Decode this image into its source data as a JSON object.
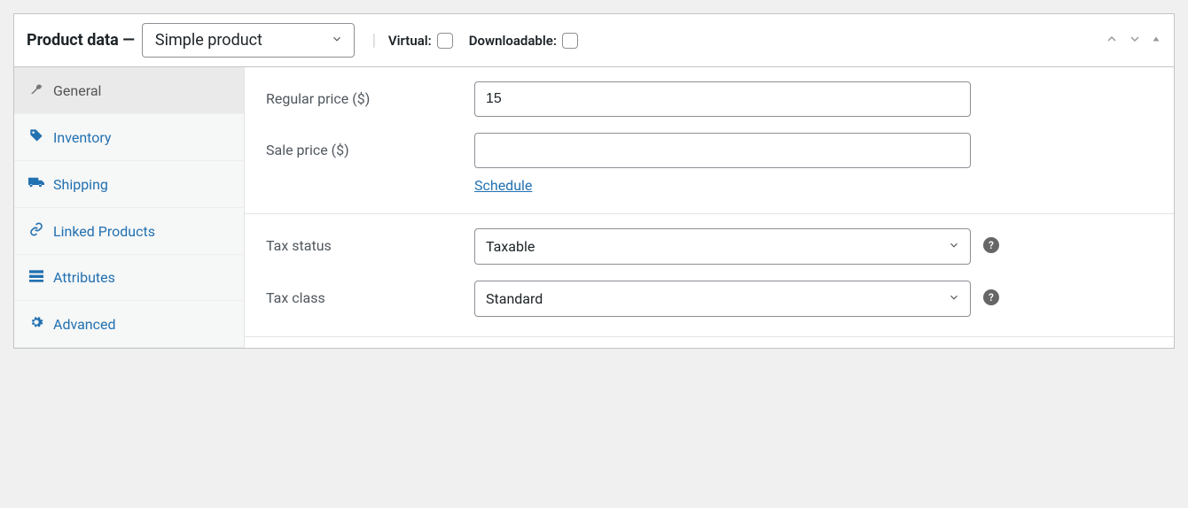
{
  "header": {
    "title": "Product data —",
    "product_type": "Simple product",
    "virtual_label": "Virtual:",
    "downloadable_label": "Downloadable:"
  },
  "tabs": [
    {
      "key": "general",
      "label": "General",
      "icon": "wrench"
    },
    {
      "key": "inventory",
      "label": "Inventory",
      "icon": "tag"
    },
    {
      "key": "shipping",
      "label": "Shipping",
      "icon": "truck"
    },
    {
      "key": "linked",
      "label": "Linked Products",
      "icon": "link"
    },
    {
      "key": "attributes",
      "label": "Attributes",
      "icon": "list"
    },
    {
      "key": "advanced",
      "label": "Advanced",
      "icon": "cog"
    }
  ],
  "pricing": {
    "regular_label": "Regular price ($)",
    "regular_value": "15",
    "sale_label": "Sale price ($)",
    "sale_value": "",
    "schedule_label": "Schedule"
  },
  "tax": {
    "status_label": "Tax status",
    "status_value": "Taxable",
    "class_label": "Tax class",
    "class_value": "Standard"
  }
}
